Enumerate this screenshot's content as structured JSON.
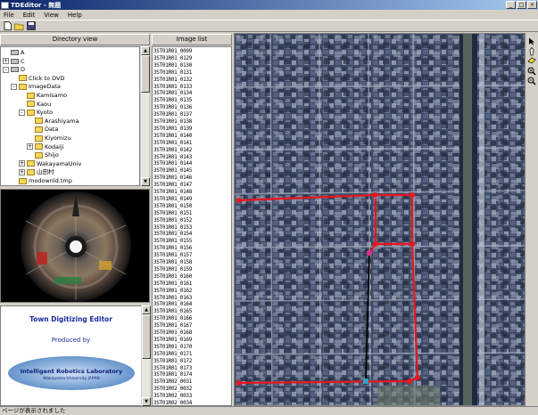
{
  "window": {
    "title": "TDEditor - 無題"
  },
  "menu": {
    "file": "File",
    "edit": "Edit",
    "view": "View",
    "help": "Help"
  },
  "panels": {
    "directory_view": "Directory view",
    "image_list": "Image list"
  },
  "tree": [
    {
      "label": "A",
      "indent": 0,
      "icon": "drive-icon",
      "expander": ""
    },
    {
      "label": "C",
      "indent": 0,
      "icon": "drive-icon",
      "expander": "+"
    },
    {
      "label": "D",
      "indent": 0,
      "icon": "drive-icon",
      "expander": "-"
    },
    {
      "label": "Click to DVD",
      "indent": 1,
      "icon": "folder-icon",
      "expander": ""
    },
    {
      "label": "ImageData",
      "indent": 1,
      "icon": "folder-icon",
      "expander": "-"
    },
    {
      "label": "Kamisamo",
      "indent": 2,
      "icon": "folder-icon",
      "expander": ""
    },
    {
      "label": "Kaou",
      "indent": 2,
      "icon": "folder-icon",
      "expander": ""
    },
    {
      "label": "Kyoto",
      "indent": 2,
      "icon": "folder-icon",
      "expander": "-"
    },
    {
      "label": "Arashiyama",
      "indent": 3,
      "icon": "folder-icon",
      "expander": ""
    },
    {
      "label": "Data",
      "indent": 3,
      "icon": "folder-icon",
      "expander": ""
    },
    {
      "label": "Kiyomizu",
      "indent": 3,
      "icon": "folder-icon",
      "expander": ""
    },
    {
      "label": "Kodaiji",
      "indent": 3,
      "icon": "folder-icon",
      "expander": "+"
    },
    {
      "label": "Shijo",
      "indent": 3,
      "icon": "folder-icon",
      "expander": ""
    },
    {
      "label": "WakayamaUniv",
      "indent": 2,
      "icon": "folder-icon",
      "expander": "+"
    },
    {
      "label": "山田村",
      "indent": 2,
      "icon": "folder-icon",
      "expander": "+"
    },
    {
      "label": "modownld.tmp",
      "indent": 1,
      "icon": "folder-icon",
      "expander": ""
    }
  ],
  "logo": {
    "title": "Town Digitizing Editor",
    "produced_by": "Produced by",
    "lab": "Intelligent Robotics Laboratory",
    "lab_sub": "Wakayama University JAPAN"
  },
  "images": [
    "3ST01R01_0099",
    "3ST01R01_0129",
    "3ST01R01_0130",
    "3ST01R01_0131",
    "3ST01R01_0132",
    "3ST01R01_0133",
    "3ST01R01_0134",
    "3ST01R01_0135",
    "3ST01R01_0136",
    "3ST01R01_0137",
    "3ST01R01_0138",
    "3ST01R01_0139",
    "3ST01R01_0140",
    "3ST01R01_0141",
    "3ST01R01_0142",
    "3ST01R01_0143",
    "3ST01R01_0144",
    "3ST01R01_0145",
    "3ST01R01_0146",
    "3ST01R01_0147",
    "3ST01R01_0148",
    "3ST01R01_0149",
    "3ST01R01_0150",
    "3ST01R01_0151",
    "3ST01R01_0152",
    "3ST01R01_0153",
    "3ST01R01_0154",
    "3ST01R01_0155",
    "3ST01R01_0156",
    "3ST01R01_0157",
    "3ST01R01_0158",
    "3ST01R01_0159",
    "3ST01R01_0160",
    "3ST01R01_0161",
    "3ST01R01_0162",
    "3ST01R01_0163",
    "3ST01R01_0164",
    "3ST01R01_0165",
    "3ST01R01_0166",
    "3ST01R01_0167",
    "3ST01R01_0168",
    "3ST01R01_0169",
    "3ST01R01_0170",
    "3ST01R01_0171",
    "3ST01R01_0172",
    "3ST01R01_0173",
    "3ST01R01_0174",
    "3ST01R02_0031",
    "3ST01R02_0032",
    "3ST01R02_0033",
    "3ST01R02_0034"
  ],
  "status": {
    "text": "ページが表示されました"
  },
  "colors": {
    "route": "#e8161e",
    "path": "#000000",
    "marker_pink": "#e0308a",
    "marker_cyan": "#30a0c8"
  }
}
